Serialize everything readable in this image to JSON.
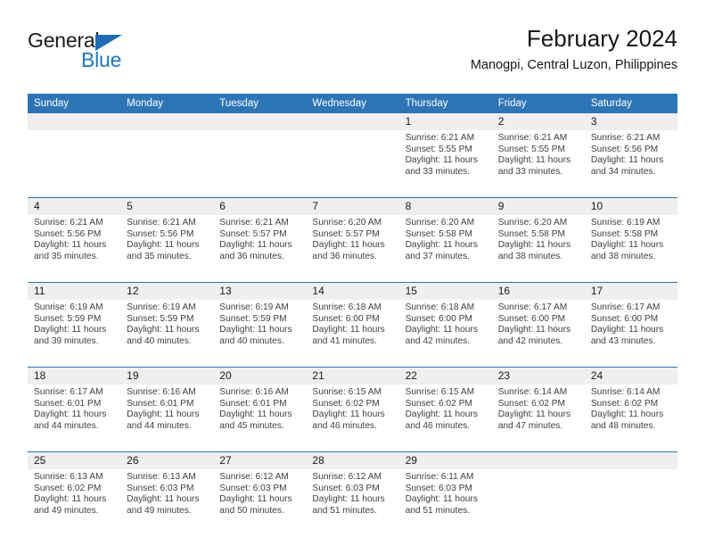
{
  "logo": {
    "text_primary": "General",
    "text_secondary": "Blue",
    "primary_color": "#1a1a1a",
    "secondary_color": "#1f78c1",
    "triangle_color": "#1f6cb4"
  },
  "header": {
    "title": "February 2024",
    "subtitle": "Manogpi, Central Luzon, Philippines"
  },
  "theme": {
    "header_blue": "#2e75b6",
    "date_band_gray": "#efefef",
    "body_text": "#404040"
  },
  "weekday_headers": [
    "Sunday",
    "Monday",
    "Tuesday",
    "Wednesday",
    "Thursday",
    "Friday",
    "Saturday"
  ],
  "weeks": [
    {
      "days": [
        {
          "date": "",
          "lines": []
        },
        {
          "date": "",
          "lines": []
        },
        {
          "date": "",
          "lines": []
        },
        {
          "date": "",
          "lines": []
        },
        {
          "date": "1",
          "lines": [
            "Sunrise: 6:21 AM",
            "Sunset: 5:55 PM",
            "Daylight: 11 hours",
            "and 33 minutes."
          ]
        },
        {
          "date": "2",
          "lines": [
            "Sunrise: 6:21 AM",
            "Sunset: 5:55 PM",
            "Daylight: 11 hours",
            "and 33 minutes."
          ]
        },
        {
          "date": "3",
          "lines": [
            "Sunrise: 6:21 AM",
            "Sunset: 5:56 PM",
            "Daylight: 11 hours",
            "and 34 minutes."
          ]
        }
      ]
    },
    {
      "days": [
        {
          "date": "4",
          "lines": [
            "Sunrise: 6:21 AM",
            "Sunset: 5:56 PM",
            "Daylight: 11 hours",
            "and 35 minutes."
          ]
        },
        {
          "date": "5",
          "lines": [
            "Sunrise: 6:21 AM",
            "Sunset: 5:56 PM",
            "Daylight: 11 hours",
            "and 35 minutes."
          ]
        },
        {
          "date": "6",
          "lines": [
            "Sunrise: 6:21 AM",
            "Sunset: 5:57 PM",
            "Daylight: 11 hours",
            "and 36 minutes."
          ]
        },
        {
          "date": "7",
          "lines": [
            "Sunrise: 6:20 AM",
            "Sunset: 5:57 PM",
            "Daylight: 11 hours",
            "and 36 minutes."
          ]
        },
        {
          "date": "8",
          "lines": [
            "Sunrise: 6:20 AM",
            "Sunset: 5:58 PM",
            "Daylight: 11 hours",
            "and 37 minutes."
          ]
        },
        {
          "date": "9",
          "lines": [
            "Sunrise: 6:20 AM",
            "Sunset: 5:58 PM",
            "Daylight: 11 hours",
            "and 38 minutes."
          ]
        },
        {
          "date": "10",
          "lines": [
            "Sunrise: 6:19 AM",
            "Sunset: 5:58 PM",
            "Daylight: 11 hours",
            "and 38 minutes."
          ]
        }
      ]
    },
    {
      "days": [
        {
          "date": "11",
          "lines": [
            "Sunrise: 6:19 AM",
            "Sunset: 5:59 PM",
            "Daylight: 11 hours",
            "and 39 minutes."
          ]
        },
        {
          "date": "12",
          "lines": [
            "Sunrise: 6:19 AM",
            "Sunset: 5:59 PM",
            "Daylight: 11 hours",
            "and 40 minutes."
          ]
        },
        {
          "date": "13",
          "lines": [
            "Sunrise: 6:19 AM",
            "Sunset: 5:59 PM",
            "Daylight: 11 hours",
            "and 40 minutes."
          ]
        },
        {
          "date": "14",
          "lines": [
            "Sunrise: 6:18 AM",
            "Sunset: 6:00 PM",
            "Daylight: 11 hours",
            "and 41 minutes."
          ]
        },
        {
          "date": "15",
          "lines": [
            "Sunrise: 6:18 AM",
            "Sunset: 6:00 PM",
            "Daylight: 11 hours",
            "and 42 minutes."
          ]
        },
        {
          "date": "16",
          "lines": [
            "Sunrise: 6:17 AM",
            "Sunset: 6:00 PM",
            "Daylight: 11 hours",
            "and 42 minutes."
          ]
        },
        {
          "date": "17",
          "lines": [
            "Sunrise: 6:17 AM",
            "Sunset: 6:00 PM",
            "Daylight: 11 hours",
            "and 43 minutes."
          ]
        }
      ]
    },
    {
      "days": [
        {
          "date": "18",
          "lines": [
            "Sunrise: 6:17 AM",
            "Sunset: 6:01 PM",
            "Daylight: 11 hours",
            "and 44 minutes."
          ]
        },
        {
          "date": "19",
          "lines": [
            "Sunrise: 6:16 AM",
            "Sunset: 6:01 PM",
            "Daylight: 11 hours",
            "and 44 minutes."
          ]
        },
        {
          "date": "20",
          "lines": [
            "Sunrise: 6:16 AM",
            "Sunset: 6:01 PM",
            "Daylight: 11 hours",
            "and 45 minutes."
          ]
        },
        {
          "date": "21",
          "lines": [
            "Sunrise: 6:15 AM",
            "Sunset: 6:02 PM",
            "Daylight: 11 hours",
            "and 46 minutes."
          ]
        },
        {
          "date": "22",
          "lines": [
            "Sunrise: 6:15 AM",
            "Sunset: 6:02 PM",
            "Daylight: 11 hours",
            "and 46 minutes."
          ]
        },
        {
          "date": "23",
          "lines": [
            "Sunrise: 6:14 AM",
            "Sunset: 6:02 PM",
            "Daylight: 11 hours",
            "and 47 minutes."
          ]
        },
        {
          "date": "24",
          "lines": [
            "Sunrise: 6:14 AM",
            "Sunset: 6:02 PM",
            "Daylight: 11 hours",
            "and 48 minutes."
          ]
        }
      ]
    },
    {
      "days": [
        {
          "date": "25",
          "lines": [
            "Sunrise: 6:13 AM",
            "Sunset: 6:02 PM",
            "Daylight: 11 hours",
            "and 49 minutes."
          ]
        },
        {
          "date": "26",
          "lines": [
            "Sunrise: 6:13 AM",
            "Sunset: 6:03 PM",
            "Daylight: 11 hours",
            "and 49 minutes."
          ]
        },
        {
          "date": "27",
          "lines": [
            "Sunrise: 6:12 AM",
            "Sunset: 6:03 PM",
            "Daylight: 11 hours",
            "and 50 minutes."
          ]
        },
        {
          "date": "28",
          "lines": [
            "Sunrise: 6:12 AM",
            "Sunset: 6:03 PM",
            "Daylight: 11 hours",
            "and 51 minutes."
          ]
        },
        {
          "date": "29",
          "lines": [
            "Sunrise: 6:11 AM",
            "Sunset: 6:03 PM",
            "Daylight: 11 hours",
            "and 51 minutes."
          ]
        },
        {
          "date": "",
          "lines": []
        },
        {
          "date": "",
          "lines": []
        }
      ]
    }
  ]
}
